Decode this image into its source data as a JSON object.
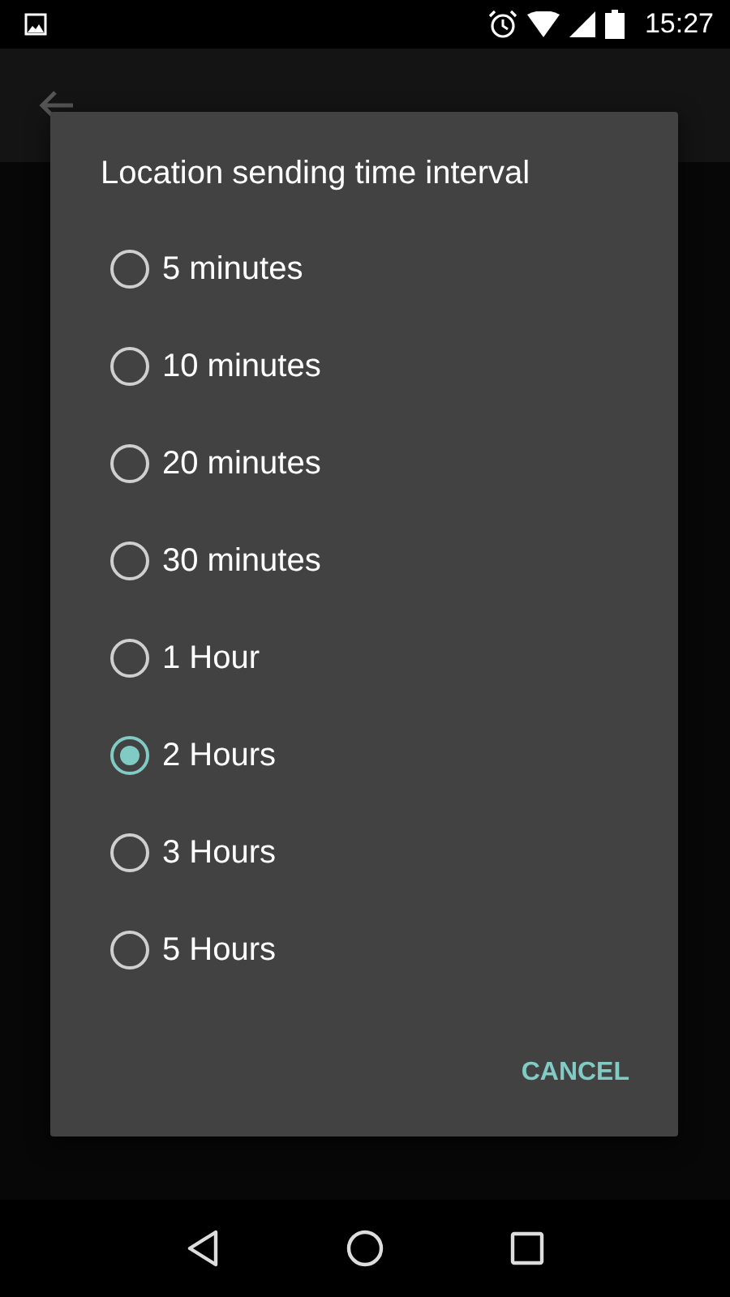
{
  "status_bar": {
    "time": "15:27"
  },
  "dialog": {
    "title": "Location sending time interval",
    "options": [
      {
        "label": "5 minutes",
        "selected": false
      },
      {
        "label": "10 minutes",
        "selected": false
      },
      {
        "label": "20 minutes",
        "selected": false
      },
      {
        "label": "30 minutes",
        "selected": false
      },
      {
        "label": "1 Hour",
        "selected": false
      },
      {
        "label": "2 Hours",
        "selected": true
      },
      {
        "label": "3 Hours",
        "selected": false
      },
      {
        "label": "5 Hours",
        "selected": false
      }
    ],
    "buttons": [
      "CANCEL"
    ]
  }
}
